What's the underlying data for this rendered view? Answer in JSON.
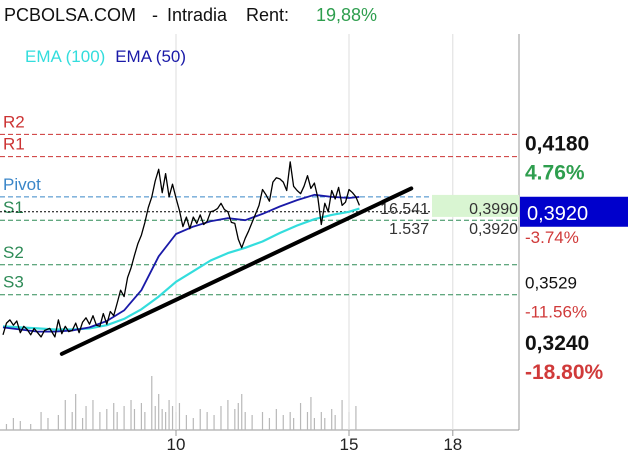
{
  "header": {
    "symbol": "PCBOLSA.COM",
    "separator": "-",
    "mode": "Intradia",
    "rent_label": "Rent:",
    "rent_value": "19,88%"
  },
  "colors": {
    "resistance": "#cc3333",
    "pivot": "#3a86c8",
    "support": "#2e8b57",
    "ema100": "#33dddd",
    "ema50": "#1a1aa8",
    "price": "#000000",
    "positive": "#2e9e4e",
    "negative": "#d03a3a",
    "current_box": "#0000cc"
  },
  "chart_data": {
    "type": "line",
    "x_ticks": [
      {
        "x": 10,
        "label": "10"
      },
      {
        "x": 15,
        "label": "15"
      },
      {
        "x": 18,
        "label": "18"
      }
    ],
    "xlim": [
      5,
      19
    ],
    "ylim": [
      0.3175,
      0.4315
    ],
    "legend": [
      {
        "name": "EMA (100)",
        "color": "#33dddd"
      },
      {
        "name": "EMA (50)",
        "color": "#1a1aa8"
      }
    ],
    "levels": [
      {
        "name": "R2",
        "value": 0.4285,
        "color": "#cc3333"
      },
      {
        "name": "R1",
        "value": 0.418,
        "color": "#cc3333"
      },
      {
        "name": "Pivot",
        "value": 0.399,
        "color": "#3a86c8"
      },
      {
        "name": "S1",
        "value": 0.388,
        "color": "#2e8b57"
      },
      {
        "name": "S2",
        "value": 0.367,
        "color": "#2e8b57"
      },
      {
        "name": "S3",
        "value": 0.3529,
        "color": "#2e8b57"
      }
    ],
    "right_axis": [
      {
        "value": 0.418,
        "label": "0,4180",
        "change": "4.76%",
        "change_color": "#2e9e4e"
      },
      {
        "value": 0.388,
        "label": "",
        "change": "-3.74%",
        "change_color": "#d03a3a"
      },
      {
        "value": 0.3529,
        "label": "0,3529",
        "change": "-11.56%",
        "change_color": "#d03a3a"
      },
      {
        "value": 0.324,
        "label": "0,3240",
        "change": "-18.80%",
        "change_color": "#d03a3a"
      }
    ],
    "current_price": {
      "value": 0.392,
      "label": "0,3920"
    },
    "quote_box": {
      "bid_size": "16.541",
      "bid": "0,3990",
      "ask_size": "1.537",
      "ask": "0,3920"
    },
    "trendline": {
      "start": {
        "x": 6.7,
        "y": 0.325
      },
      "end": {
        "x": 16.8,
        "y": 0.403
      }
    },
    "price_series": [
      [
        5.0,
        0.334
      ],
      [
        5.1,
        0.3395
      ],
      [
        5.2,
        0.341
      ],
      [
        5.3,
        0.3385
      ],
      [
        5.4,
        0.3405
      ],
      [
        5.5,
        0.335
      ],
      [
        5.6,
        0.338
      ],
      [
        5.7,
        0.3365
      ],
      [
        5.8,
        0.334
      ],
      [
        5.9,
        0.337
      ],
      [
        6.0,
        0.335
      ],
      [
        6.1,
        0.333
      ],
      [
        6.2,
        0.336
      ],
      [
        6.35,
        0.337
      ],
      [
        6.5,
        0.333
      ],
      [
        6.6,
        0.341
      ],
      [
        6.7,
        0.3345
      ],
      [
        6.8,
        0.338
      ],
      [
        6.9,
        0.3355
      ],
      [
        7.0,
        0.336
      ],
      [
        7.1,
        0.3395
      ],
      [
        7.2,
        0.335
      ],
      [
        7.3,
        0.34
      ],
      [
        7.4,
        0.342
      ],
      [
        7.5,
        0.339
      ],
      [
        7.6,
        0.343
      ],
      [
        7.7,
        0.3385
      ],
      [
        7.8,
        0.338
      ],
      [
        7.9,
        0.344
      ],
      [
        8.0,
        0.339
      ],
      [
        8.1,
        0.345
      ],
      [
        8.2,
        0.343
      ],
      [
        8.3,
        0.349
      ],
      [
        8.4,
        0.355
      ],
      [
        8.5,
        0.352
      ],
      [
        8.6,
        0.361
      ],
      [
        8.7,
        0.3655
      ],
      [
        8.8,
        0.3715
      ],
      [
        8.9,
        0.377
      ],
      [
        9.0,
        0.381
      ],
      [
        9.1,
        0.387
      ],
      [
        9.2,
        0.394
      ],
      [
        9.3,
        0.399
      ],
      [
        9.4,
        0.4065
      ],
      [
        9.5,
        0.412
      ],
      [
        9.6,
        0.401
      ],
      [
        9.7,
        0.41
      ],
      [
        9.8,
        0.399
      ],
      [
        9.9,
        0.405
      ],
      [
        10.0,
        0.3985
      ],
      [
        10.1,
        0.3925
      ],
      [
        10.2,
        0.385
      ],
      [
        10.3,
        0.3895
      ],
      [
        10.4,
        0.384
      ],
      [
        10.5,
        0.3895
      ],
      [
        10.6,
        0.3865
      ],
      [
        10.7,
        0.3905
      ],
      [
        10.8,
        0.386
      ],
      [
        10.9,
        0.3875
      ],
      [
        11.0,
        0.392
      ],
      [
        11.1,
        0.3925
      ],
      [
        11.2,
        0.3935
      ],
      [
        11.3,
        0.396
      ],
      [
        11.4,
        0.393
      ],
      [
        11.5,
        0.392
      ],
      [
        11.6,
        0.387
      ],
      [
        11.7,
        0.3865
      ],
      [
        11.8,
        0.379
      ],
      [
        11.9,
        0.375
      ],
      [
        12.0,
        0.3795
      ],
      [
        12.1,
        0.383
      ],
      [
        12.2,
        0.387
      ],
      [
        12.3,
        0.391
      ],
      [
        12.4,
        0.395
      ],
      [
        12.5,
        0.4025
      ],
      [
        12.6,
        0.4
      ],
      [
        12.7,
        0.397
      ],
      [
        12.8,
        0.406
      ],
      [
        12.9,
        0.408
      ],
      [
        13.0,
        0.4075
      ],
      [
        13.1,
        0.406
      ],
      [
        13.2,
        0.402
      ],
      [
        13.3,
        0.4155
      ],
      [
        13.4,
        0.404
      ],
      [
        13.5,
        0.402
      ],
      [
        13.6,
        0.4005
      ],
      [
        13.7,
        0.404
      ],
      [
        13.8,
        0.409
      ],
      [
        13.9,
        0.403
      ],
      [
        14.0,
        0.4055
      ],
      [
        14.1,
        0.3985
      ],
      [
        14.2,
        0.386
      ],
      [
        14.3,
        0.396
      ],
      [
        14.4,
        0.392
      ],
      [
        14.5,
        0.402
      ],
      [
        14.6,
        0.398
      ],
      [
        14.7,
        0.4035
      ],
      [
        14.8,
        0.395
      ],
      [
        14.9,
        0.3965
      ],
      [
        15.0,
        0.4025
      ],
      [
        15.1,
        0.401
      ],
      [
        15.2,
        0.399
      ],
      [
        15.3,
        0.395
      ]
    ],
    "ema100_series": [
      [
        5.0,
        0.338
      ],
      [
        5.5,
        0.3375
      ],
      [
        6.0,
        0.337
      ],
      [
        6.5,
        0.3365
      ],
      [
        7.0,
        0.3365
      ],
      [
        7.5,
        0.337
      ],
      [
        8.0,
        0.3385
      ],
      [
        8.5,
        0.3415
      ],
      [
        9.0,
        0.346
      ],
      [
        9.5,
        0.352
      ],
      [
        10.0,
        0.359
      ],
      [
        10.5,
        0.364
      ],
      [
        11.0,
        0.369
      ],
      [
        11.5,
        0.3725
      ],
      [
        12.0,
        0.375
      ],
      [
        12.5,
        0.378
      ],
      [
        13.0,
        0.382
      ],
      [
        13.5,
        0.3855
      ],
      [
        14.0,
        0.3885
      ],
      [
        14.5,
        0.3905
      ],
      [
        15.0,
        0.392
      ],
      [
        15.3,
        0.3935
      ]
    ],
    "ema50_series": [
      [
        5.0,
        0.3375
      ],
      [
        5.5,
        0.3365
      ],
      [
        6.0,
        0.3355
      ],
      [
        6.5,
        0.3355
      ],
      [
        7.0,
        0.336
      ],
      [
        7.5,
        0.3375
      ],
      [
        8.0,
        0.3405
      ],
      [
        8.5,
        0.3455
      ],
      [
        9.0,
        0.355
      ],
      [
        9.5,
        0.371
      ],
      [
        10.0,
        0.3815
      ],
      [
        10.5,
        0.385
      ],
      [
        11.0,
        0.3875
      ],
      [
        11.5,
        0.389
      ],
      [
        12.0,
        0.388
      ],
      [
        12.5,
        0.391
      ],
      [
        13.0,
        0.3945
      ],
      [
        13.5,
        0.3975
      ],
      [
        14.0,
        0.4
      ],
      [
        14.5,
        0.399
      ],
      [
        15.0,
        0.3985
      ],
      [
        15.3,
        0.399
      ]
    ],
    "volume_series": [
      [
        5.1,
        0.1
      ],
      [
        5.3,
        0.2
      ],
      [
        5.5,
        0.15
      ],
      [
        5.8,
        0.1
      ],
      [
        6.1,
        0.3
      ],
      [
        6.3,
        0.2
      ],
      [
        6.6,
        0.25
      ],
      [
        6.8,
        0.5
      ],
      [
        7.0,
        0.3
      ],
      [
        7.1,
        0.6
      ],
      [
        7.3,
        0.2
      ],
      [
        7.4,
        0.4
      ],
      [
        7.6,
        0.5
      ],
      [
        7.8,
        0.3
      ],
      [
        8.0,
        0.35
      ],
      [
        8.2,
        0.45
      ],
      [
        8.3,
        0.3
      ],
      [
        8.5,
        0.4
      ],
      [
        8.7,
        0.5
      ],
      [
        8.8,
        0.35
      ],
      [
        9.0,
        0.45
      ],
      [
        9.1,
        0.3
      ],
      [
        9.3,
        0.9
      ],
      [
        9.4,
        0.4
      ],
      [
        9.5,
        0.6
      ],
      [
        9.6,
        0.35
      ],
      [
        9.7,
        0.3
      ],
      [
        9.8,
        0.5
      ],
      [
        9.9,
        0.4
      ],
      [
        10.0,
        0.3
      ],
      [
        10.1,
        0.45
      ],
      [
        10.3,
        0.25
      ],
      [
        10.5,
        0.2
      ],
      [
        10.7,
        0.35
      ],
      [
        10.9,
        0.3
      ],
      [
        11.1,
        0.25
      ],
      [
        11.3,
        0.4
      ],
      [
        11.5,
        0.5
      ],
      [
        11.7,
        0.35
      ],
      [
        11.8,
        0.45
      ],
      [
        11.9,
        0.6
      ],
      [
        12.0,
        0.3
      ],
      [
        12.2,
        0.25
      ],
      [
        12.5,
        0.3
      ],
      [
        12.7,
        0.2
      ],
      [
        12.9,
        0.35
      ],
      [
        13.1,
        0.25
      ],
      [
        13.3,
        0.3
      ],
      [
        13.4,
        0.2
      ],
      [
        13.6,
        0.45
      ],
      [
        13.8,
        0.3
      ],
      [
        13.9,
        0.55
      ],
      [
        14.0,
        0.2
      ],
      [
        14.2,
        0.3
      ],
      [
        14.3,
        0.2
      ],
      [
        14.5,
        0.35
      ],
      [
        14.6,
        0.25
      ],
      [
        14.8,
        0.5
      ],
      [
        15.0,
        0.3
      ],
      [
        15.2,
        0.4
      ]
    ]
  }
}
